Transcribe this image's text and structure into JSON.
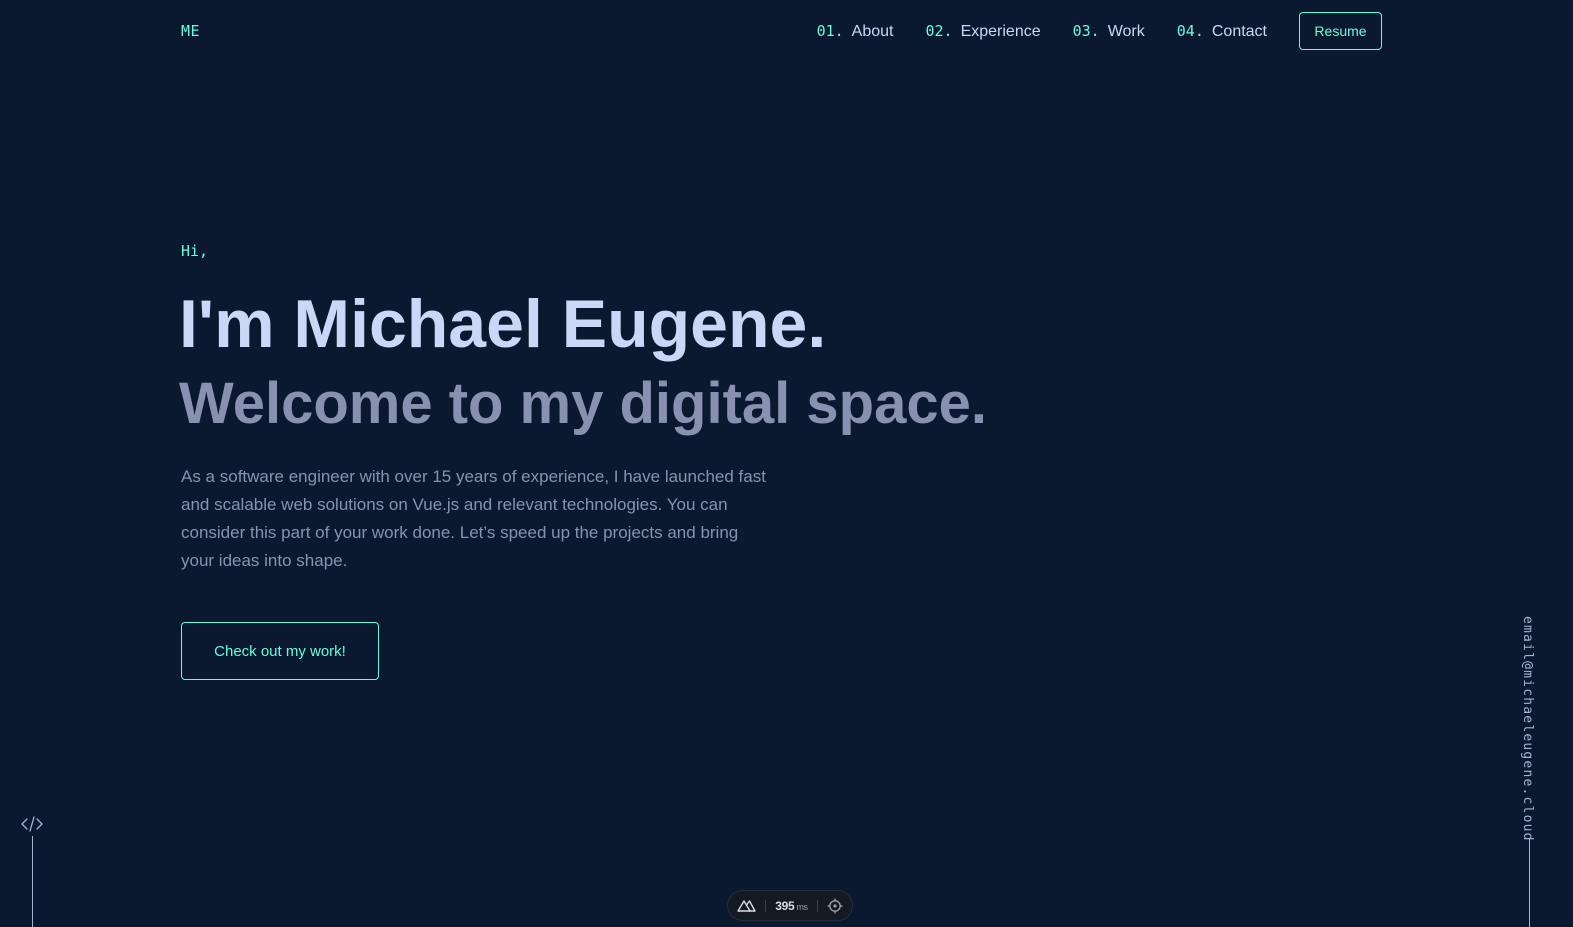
{
  "header": {
    "logo": "ME",
    "nav": [
      {
        "num": "01.",
        "label": "About"
      },
      {
        "num": "02.",
        "label": "Experience"
      },
      {
        "num": "03.",
        "label": "Work"
      },
      {
        "num": "04.",
        "label": "Contact"
      }
    ],
    "resume_label": "Resume"
  },
  "hero": {
    "greeting": "Hi,",
    "name": "I'm Michael Eugene.",
    "tagline": "Welcome to my digital space.",
    "intro": "As a software engineer with over 15 years of experience, I have launched fast and scalable web solutions on Vue.js and relevant technologies. You can consider this part of your work done. Let’s speed up the projects and bring your ideas into shape.",
    "cta_label": "Check out my work!"
  },
  "side": {
    "email": "email@michaeleugene.cloud",
    "left_icon": "code-icon"
  },
  "devtools": {
    "logo_icon": "nuxt-icon",
    "timing_value": "395",
    "timing_unit": "ms",
    "inspect_icon": "crosshair-icon"
  },
  "colors": {
    "background": "#0b1930",
    "accent": "#64ffda",
    "heading": "#ccd6f6",
    "muted": "#8892b0"
  }
}
